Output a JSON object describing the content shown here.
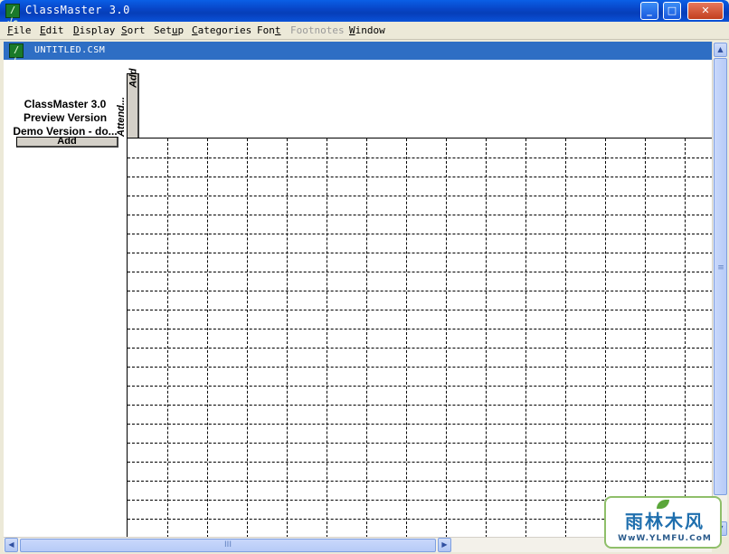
{
  "window": {
    "title": "ClassMaster 3.0",
    "icon": "classmaster-app-icon",
    "icon_glyph": "/√c",
    "minimize_glyph": "_",
    "maximize_glyph": "□",
    "close_glyph": "✕"
  },
  "menu": [
    {
      "label": "File",
      "underline": "F",
      "rest": "ile",
      "enabled": true
    },
    {
      "label": "Edit",
      "underline": "E",
      "rest": "dit",
      "enabled": true
    },
    {
      "label": "Display",
      "underline": "D",
      "rest": "isplay",
      "enabled": true
    },
    {
      "label": "Sort",
      "underline": "S",
      "rest": "ort",
      "enabled": true
    },
    {
      "label": "Setup",
      "pre": "Set",
      "underline": "u",
      "rest": "p",
      "enabled": true
    },
    {
      "label": "Categories",
      "underline": "C",
      "rest": "ategories",
      "enabled": true
    },
    {
      "label": "Font",
      "pre": "Fon",
      "underline": "t",
      "rest": "",
      "enabled": true
    },
    {
      "label": "Footnotes",
      "enabled": false
    },
    {
      "label": "Window",
      "underline": "W",
      "rest": "indow",
      "enabled": true
    }
  ],
  "document": {
    "title": "UNTITLED.CSM",
    "info_lines": [
      "ClassMaster 3.0",
      "Preview Version",
      "Demo Version - do..."
    ],
    "add_student_label": "Add",
    "column_header_label": "Attend...",
    "add_column_label": "Add"
  },
  "scrollbars": {
    "vertical_grip": "≡",
    "horizontal_grip": "III",
    "up_arrow": "▲",
    "down_arrow": "▼",
    "left_arrow": "◀",
    "right_arrow": "▶"
  },
  "watermark": {
    "main": "雨林木风",
    "sub": "WwW.YLMFU.CoM"
  }
}
